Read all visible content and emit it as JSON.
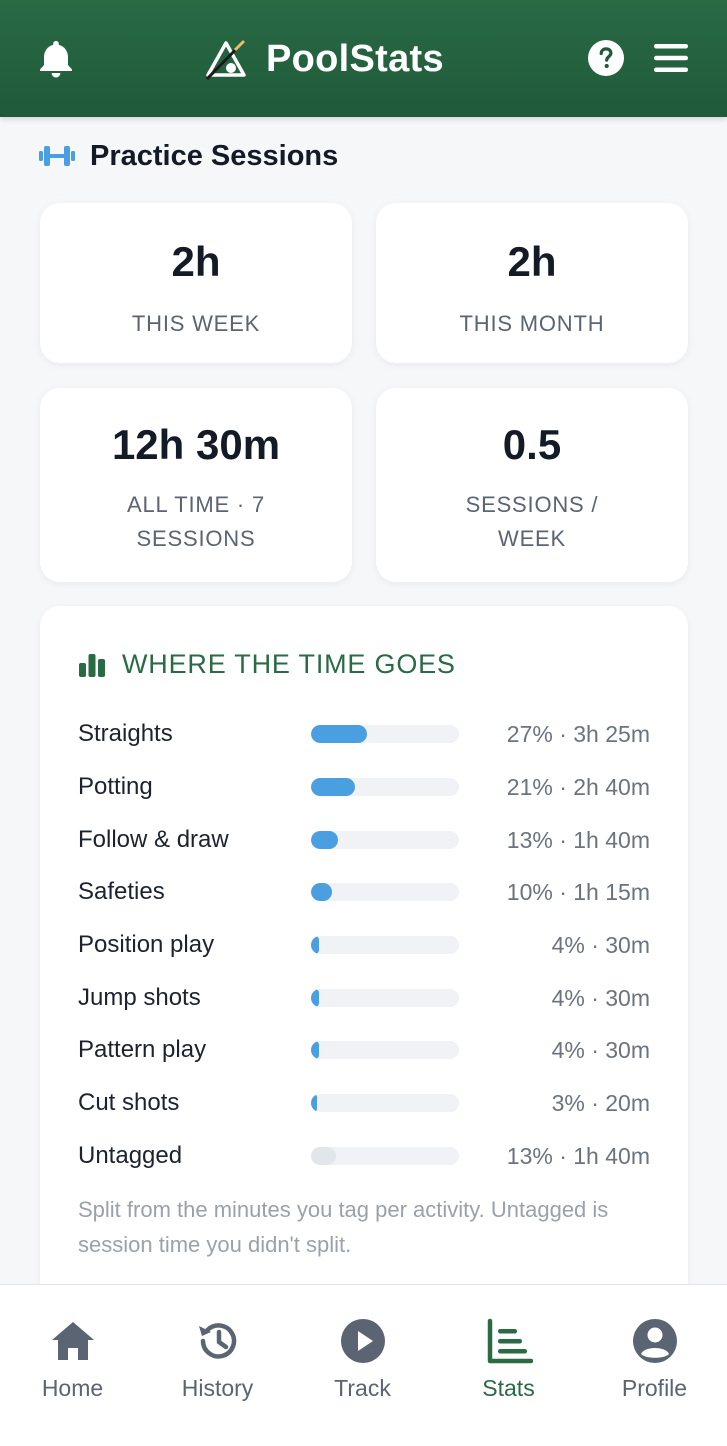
{
  "header": {
    "title": "PoolStats",
    "icons": {
      "left": "bell-icon",
      "logo": "cue-ball-logo",
      "help": "help-circle-icon",
      "menu": "menu-icon"
    }
  },
  "section": {
    "title": "Practice Sessions",
    "icon": "dumbbell-icon"
  },
  "stats": [
    {
      "value": "2h",
      "label": "THIS WEEK"
    },
    {
      "value": "2h",
      "label": "THIS MONTH"
    },
    {
      "value": "12h 30m",
      "label": "ALL TIME · 7 SESSIONS"
    },
    {
      "value": "0.5",
      "label": "SESSIONS / WEEK"
    }
  ],
  "time_breakdown": {
    "title": "WHERE THE TIME GOES",
    "icon": "bar-chart-icon",
    "rows": [
      {
        "label": "Straights",
        "value": "27% · 3h 25m",
        "fraction": 0.27
      },
      {
        "label": "Potting",
        "value": "21% · 2h 40m",
        "fraction": 0.21
      },
      {
        "label": "Follow & draw",
        "value": "13% · 1h 40m",
        "fraction": 0.13
      },
      {
        "label": "Safeties",
        "value": "10% · 1h 15m",
        "fraction": 0.1
      },
      {
        "label": "Position play",
        "value": "4% · 30m",
        "fraction": 0.04
      },
      {
        "label": "Jump shots",
        "value": "4% · 30m",
        "fraction": 0.04
      },
      {
        "label": "Pattern play",
        "value": "4% · 30m",
        "fraction": 0.04
      },
      {
        "label": "Cut shots",
        "value": "3% · 20m",
        "fraction": 0.03
      },
      {
        "label": "Untagged",
        "value": "13% · 1h 40m",
        "fraction": 0.13,
        "untagged": true
      }
    ],
    "footnote": "Split from the minutes you tag per activity. Untagged is session time you didn't split."
  },
  "colors": {
    "brand_green": "#2a6a45",
    "bar_blue": "#4a9fe0",
    "bar_grey": "#e2e5ea"
  },
  "nav": [
    {
      "label": "Home",
      "icon": "home-icon"
    },
    {
      "label": "History",
      "icon": "history-icon"
    },
    {
      "label": "Track",
      "icon": "play-circle-icon"
    },
    {
      "label": "Stats",
      "icon": "stats-icon",
      "active": true
    },
    {
      "label": "Profile",
      "icon": "profile-icon"
    }
  ]
}
